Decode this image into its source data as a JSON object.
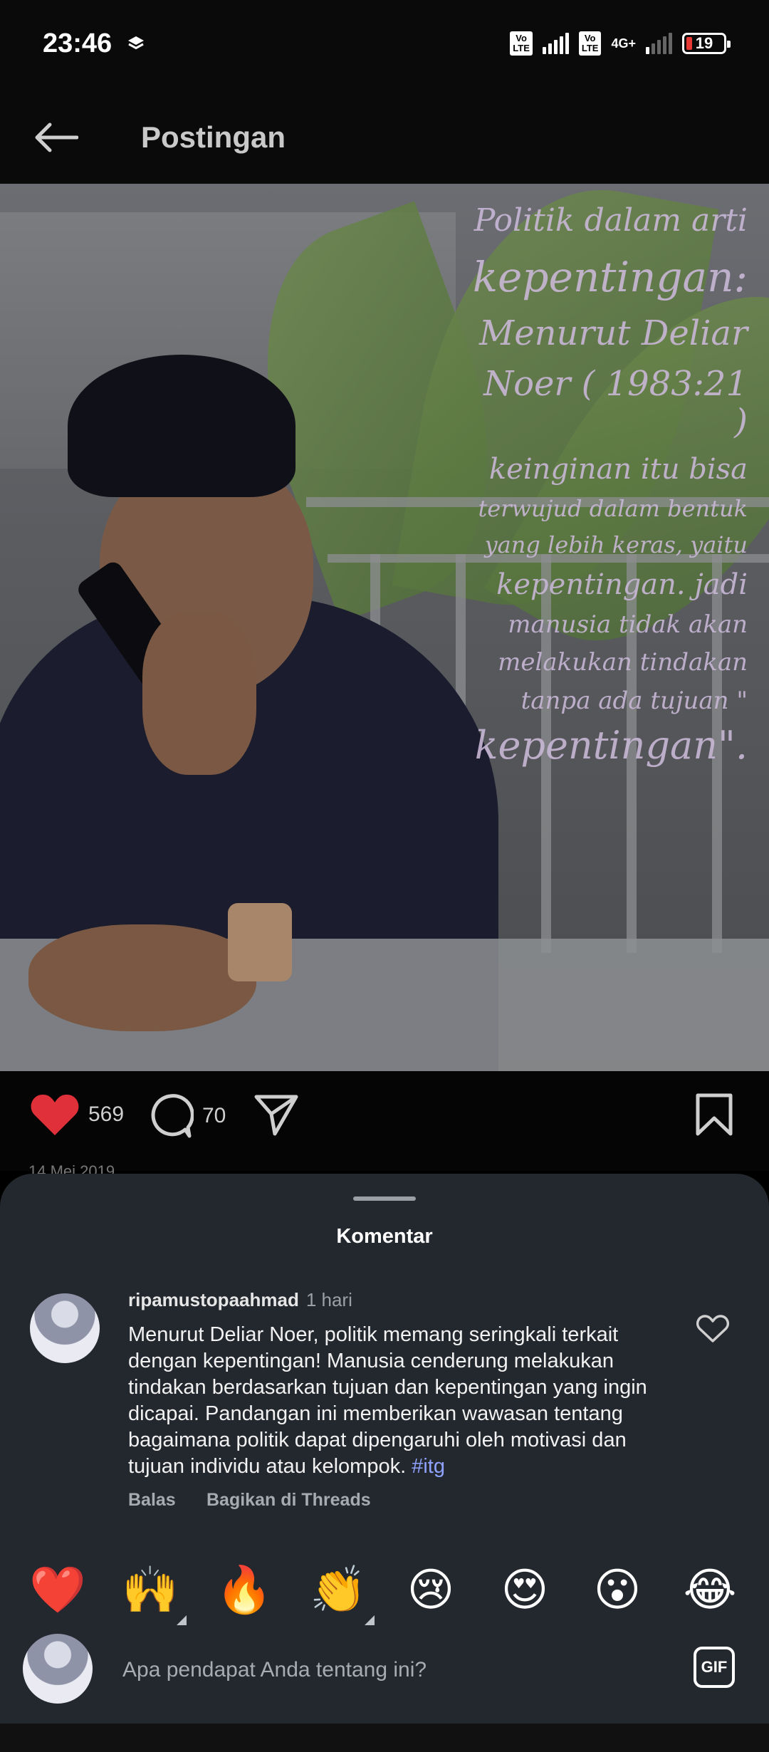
{
  "status_bar": {
    "time": "23:46",
    "network_label": "4G+",
    "volte_label": "Vo\nLTE",
    "battery_level": "19"
  },
  "header": {
    "title": "Postingan",
    "back_icon": "arrow-left-icon"
  },
  "post": {
    "image_quote_lines": [
      "Politik dalam arti",
      "kepentingan:",
      "Menurut Deliar",
      "Noer ( 1983:21 )",
      "keinginan itu bisa",
      "terwujud dalam bentuk",
      "yang lebih keras, yaitu",
      "kepentingan. jadi",
      "manusia tidak akan",
      "melakukan tindakan",
      "tanpa ada tujuan \"",
      "kepentingan\"."
    ],
    "likes": "569",
    "comments": "70",
    "date": "14 Mei 2019"
  },
  "comments_sheet": {
    "title": "Komentar",
    "comment": {
      "username": "ripamustopaahmad",
      "time": "1 hari",
      "text": "Menurut Deliar Noer, politik memang seringkali terkait dengan kepentingan! Manusia cenderung melakukan tindakan berdasarkan tujuan dan kepentingan yang ingin dicapai.  Pandangan ini memberikan wawasan tentang bagaimana politik dapat dipengaruhi oleh motivasi dan tujuan individu atau kelompok.",
      "hashtag": "#itg",
      "reply_label": "Balas",
      "share_label": "Bagikan di Threads"
    },
    "emojis": [
      "❤️",
      "🙌",
      "🔥",
      "👏",
      "😢",
      "😍",
      "😮",
      "😂"
    ],
    "input_placeholder": "Apa pendapat Anda tentang ini?",
    "gif_label": "GIF"
  },
  "colors": {
    "like_red": "#e0303a",
    "hashtag": "#8fa2ff",
    "sheet_bg": "#23272e"
  }
}
